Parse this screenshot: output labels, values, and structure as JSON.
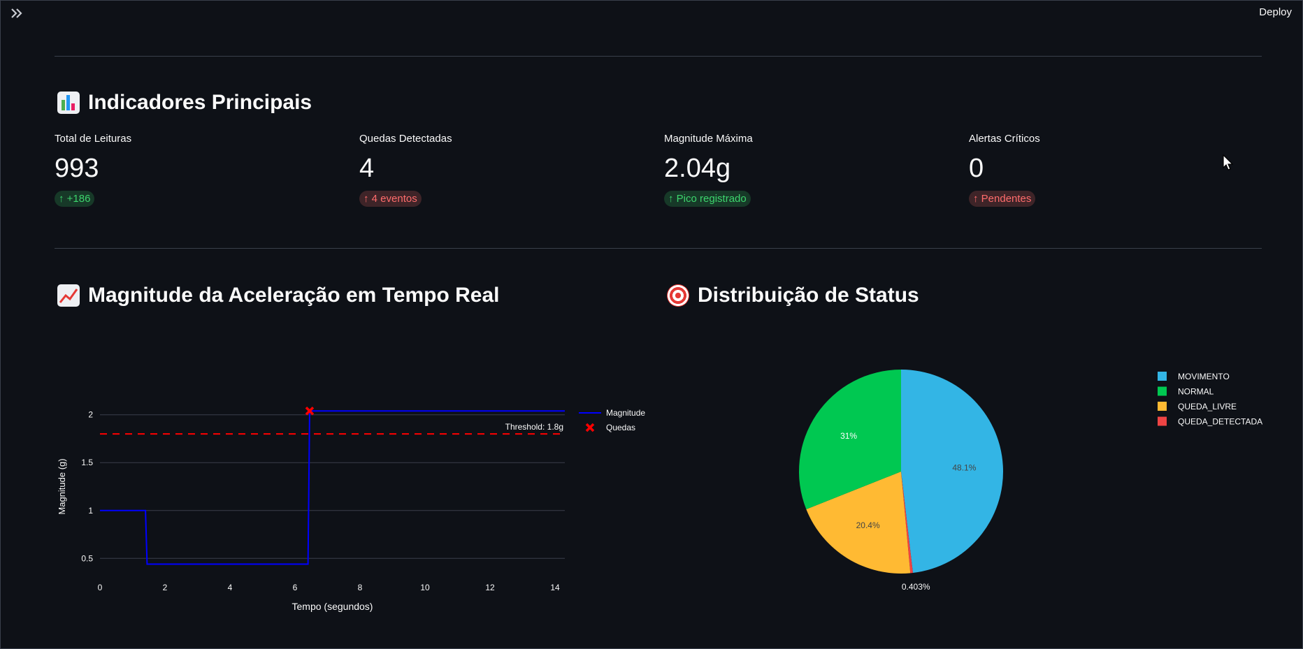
{
  "header": {
    "deploy_label": "Deploy"
  },
  "icons": {
    "sidebar_toggle": "double-chevron-right-icon",
    "cursor": "mouse-pointer-icon"
  },
  "sections": {
    "kpis": {
      "title": "Indicadores Principais",
      "icon": "bar-chart-emoji"
    },
    "timeseries": {
      "title": "Magnitude da Aceleração em Tempo Real",
      "icon": "chart-increasing-emoji"
    },
    "distribution": {
      "title": "Distribuição de Status",
      "icon": "direct-hit-emoji"
    }
  },
  "metrics": [
    {
      "label": "Total de Leituras",
      "value": "993",
      "delta": "+186",
      "delta_color": "#3dd56d",
      "trend": "up"
    },
    {
      "label": "Quedas Detectadas",
      "value": "4",
      "delta": "4 eventos",
      "delta_color": "#ff6c6c",
      "trend": "up"
    },
    {
      "label": "Magnitude Máxima",
      "value": "2.04g",
      "delta": "Pico registrado",
      "delta_color": "#3dd56d",
      "trend": "up"
    },
    {
      "label": "Alertas Críticos",
      "value": "0",
      "delta": "Pendentes",
      "delta_color": "#ff6c6c",
      "trend": "up"
    }
  ],
  "chart_data": [
    {
      "type": "line",
      "title": "",
      "xlabel": "Tempo (segundos)",
      "ylabel": "Magnitude (g)",
      "xlim": [
        0,
        14.3
      ],
      "ylim": [
        0.4,
        2.1
      ],
      "xticks": [
        0,
        2,
        4,
        6,
        8,
        10,
        12,
        14
      ],
      "yticks": [
        0.5,
        1,
        1.5,
        2
      ],
      "grid": true,
      "legend_position": "right",
      "series": [
        {
          "name": "Magnitude",
          "color": "#0000ff",
          "x": [
            0,
            1.4,
            1.45,
            6.4,
            6.45,
            14.3
          ],
          "y": [
            1.0,
            1.0,
            0.44,
            0.44,
            2.04,
            2.04
          ]
        },
        {
          "name": "Quedas",
          "color": "#ff0000",
          "marker": "x",
          "x": [
            6.45
          ],
          "y": [
            2.04
          ]
        }
      ],
      "threshold": {
        "value": 1.8,
        "label": "Threshold: 1.8g",
        "color": "#ff0000",
        "style": "dashed"
      }
    },
    {
      "type": "pie",
      "title": "",
      "legend_position": "right",
      "slices": [
        {
          "label": "MOVIMENTO",
          "value": 48.1,
          "text": "48.1%",
          "color": "#33b5e5"
        },
        {
          "label": "QUEDA_DETECTADA",
          "value": 0.403,
          "text": "0.403%",
          "color": "#ee4444"
        },
        {
          "label": "QUEDA_LIVRE",
          "value": 20.4,
          "text": "20.4%",
          "color": "#ffba33"
        },
        {
          "label": "NORMAL",
          "value": 31,
          "text": "31%",
          "color": "#00c851"
        }
      ],
      "legend": [
        "MOVIMENTO",
        "NORMAL",
        "QUEDA_LIVRE",
        "QUEDA_DETECTADA"
      ]
    }
  ]
}
